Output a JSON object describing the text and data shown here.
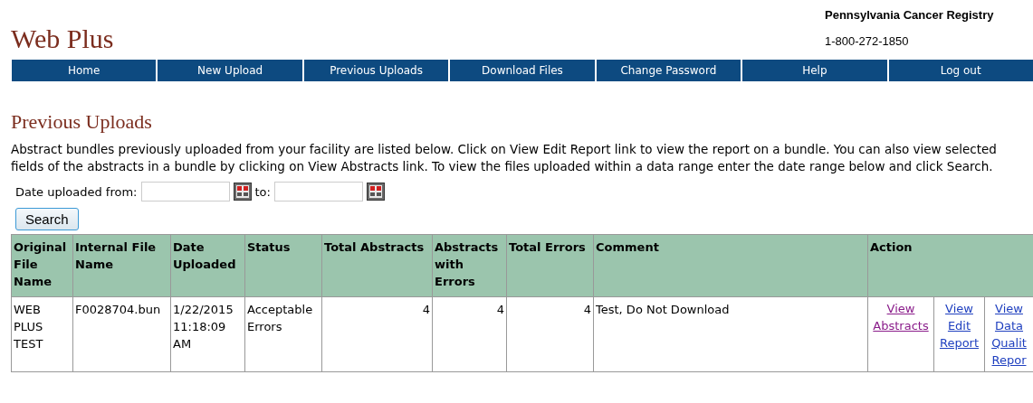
{
  "header": {
    "logo": "Web Plus",
    "organization": "Pennsylvania Cancer Registry",
    "phone": "1-800-272-1850"
  },
  "nav": [
    {
      "label": "Home"
    },
    {
      "label": "New Upload"
    },
    {
      "label": "Previous Uploads"
    },
    {
      "label": "Download Files"
    },
    {
      "label": "Change Password"
    },
    {
      "label": "Help"
    },
    {
      "label": "Log out"
    }
  ],
  "page_title": "Previous Uploads",
  "intro": "Abstract bundles previously uploaded from your facility are listed below. Click on View Edit Report link to view the report on a bundle. You can also view selected fields of the abstracts in a bundle by clicking on View Abstracts link. To view the files uploaded within a data range enter the date range below and click Search.",
  "filter": {
    "from_label": "Date uploaded from:",
    "to_label": "to:",
    "button": "Search"
  },
  "table": {
    "columns": [
      "Original File Name",
      "Internal File Name",
      "Date Uploaded",
      "Status",
      "Total Abstracts",
      "Abstracts with Errors",
      "Total Errors",
      "Comment",
      "Action"
    ],
    "rows": [
      {
        "cells": [
          "WEB PLUS TEST",
          "F0028704.bun",
          "1/22/2015 11:18:09 AM",
          "Acceptable Errors",
          "4",
          "4",
          "4",
          "Test, Do Not Download"
        ],
        "actions": [
          {
            "label": "View Abstracts",
            "visited": true
          },
          {
            "label": "View Edit Report",
            "visited": false
          },
          {
            "label": "View Data Qualit Repor",
            "visited": false
          }
        ]
      }
    ]
  }
}
